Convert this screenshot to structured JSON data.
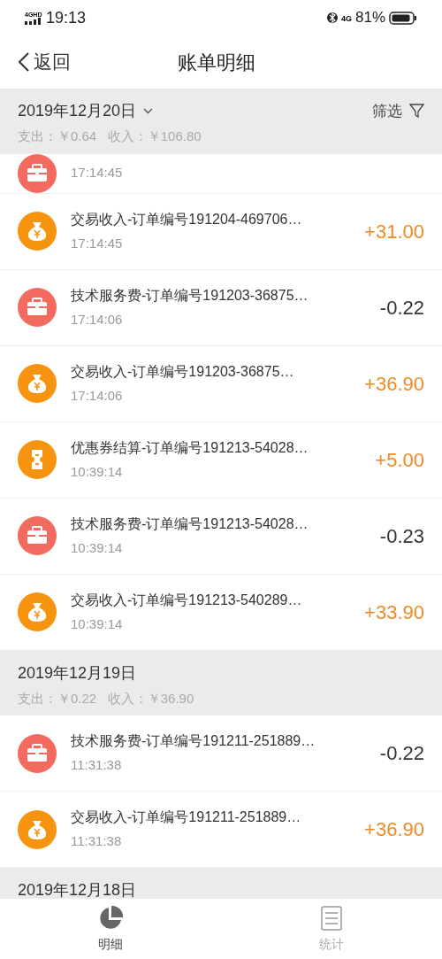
{
  "status_bar": {
    "network": "4GHD",
    "time": "19:13",
    "mobile": "4G",
    "battery": "81%"
  },
  "header": {
    "back": "返回",
    "title": "账单明细"
  },
  "groups": [
    {
      "date": "2019年12月20日",
      "dropdown": true,
      "filter": "筛选",
      "summary": "支出：￥0.64   收入：￥106.80",
      "rows": [
        {
          "kind": "fee",
          "partial": true,
          "time": "17:14:45"
        },
        {
          "kind": "income",
          "partial": false,
          "title": "交易收入-订单编号191204-469706…",
          "time": "17:14:45",
          "amount": "+31.00"
        },
        {
          "kind": "fee",
          "partial": false,
          "title": "技术服务费-订单编号191203-36875…",
          "time": "17:14:06",
          "amount": "-0.22"
        },
        {
          "kind": "income",
          "partial": false,
          "title": "交易收入-订单编号191203-36875…",
          "time": "17:14:06",
          "amount": "+36.90"
        },
        {
          "kind": "coupon",
          "partial": false,
          "title": "优惠券结算-订单编号191213-54028…",
          "time": "10:39:14",
          "amount": "+5.00"
        },
        {
          "kind": "fee",
          "partial": false,
          "title": "技术服务费-订单编号191213-54028…",
          "time": "10:39:14",
          "amount": "-0.23"
        },
        {
          "kind": "income",
          "partial": false,
          "title": "交易收入-订单编号191213-540289…",
          "time": "10:39:14",
          "amount": "+33.90"
        }
      ]
    },
    {
      "date": "2019年12月19日",
      "dropdown": false,
      "summary": "支出：￥0.22   收入：￥36.90",
      "rows": [
        {
          "kind": "fee",
          "partial": false,
          "title": "技术服务费-订单编号191211-251889…",
          "time": "11:31:38",
          "amount": "-0.22"
        },
        {
          "kind": "income",
          "partial": false,
          "title": "交易收入-订单编号191211-251889…",
          "time": "11:31:38",
          "amount": "+36.90"
        }
      ]
    },
    {
      "date": "2019年12月18日",
      "dropdown": false
    }
  ],
  "tabs": [
    {
      "label": "明细",
      "selected": true
    },
    {
      "label": "统计",
      "selected": false
    }
  ]
}
